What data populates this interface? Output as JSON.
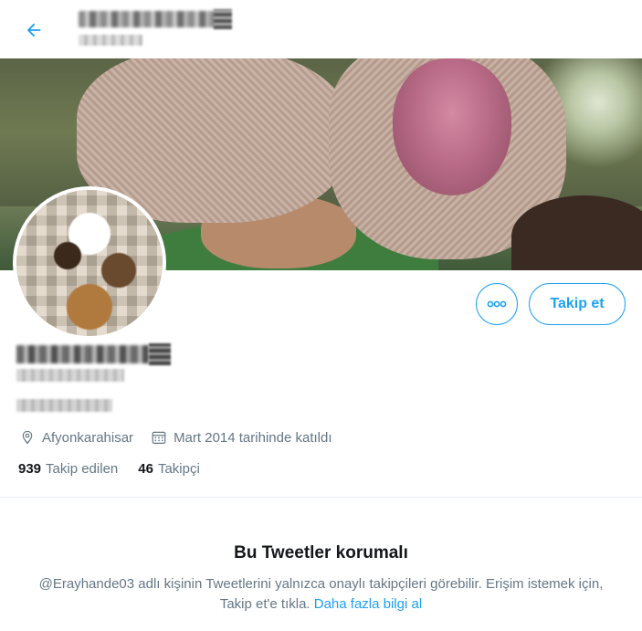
{
  "colors": {
    "accent": "#1da1f2",
    "text_primary": "#14171a",
    "text_secondary": "#657786",
    "divider": "#e6ecf0"
  },
  "header": {
    "back_icon": "arrow-left-icon"
  },
  "profile_actions": {
    "more_icon": "more-horizontal-icon",
    "follow_label": "Takip et"
  },
  "profile": {
    "location": "Afyonkarahisar",
    "location_icon": "location-pin-icon",
    "joined": "Mart 2014 tarihinde katıldı",
    "joined_icon": "calendar-icon"
  },
  "stats": {
    "following_count": "939",
    "following_label": "Takip edilen",
    "followers_count": "46",
    "followers_label": "Takipçi"
  },
  "protected_notice": {
    "title": "Bu Tweetler korumalı",
    "message": "@Erayhande03 adlı kişinin Tweetlerini yalnızca onaylı takipçileri görebilir. Erişim istemek için, Takip et'e tıkla. ",
    "link_label": "Daha fazla bilgi al"
  }
}
